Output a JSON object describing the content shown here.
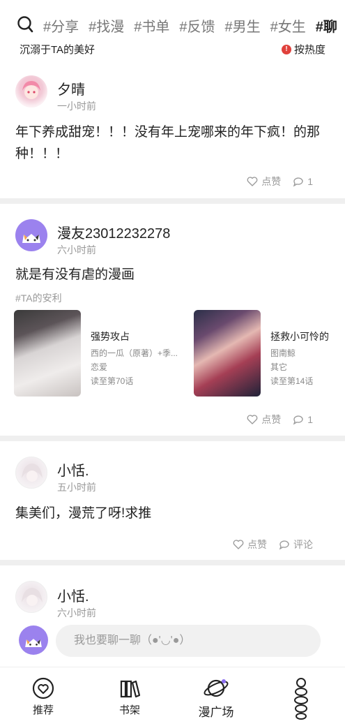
{
  "topbar": {
    "tags": [
      "#分享",
      "#找漫",
      "#书单",
      "#反馈",
      "#男生",
      "#女生",
      "#聊"
    ],
    "slogan": "沉溺于TA的美好",
    "sort_label": "按热度"
  },
  "posts": [
    {
      "user": "夕晴",
      "time": "一小时前",
      "content": "年下养成甜宠！！！没有年上宠哪来的年下疯！的那种！！！",
      "like_label": "点赞",
      "comment_label": "1"
    },
    {
      "user": "漫友23012232278",
      "time": "六小时前",
      "content": "就是有没有虐的漫画",
      "hashtag": "#TA的安利",
      "comics": [
        {
          "title": "强势攻占",
          "author": "西的一瓜（原著）+季...",
          "genre": "恋爱",
          "progress": "读至第70话"
        },
        {
          "title": "拯救小可怜的",
          "author": "图南鲸",
          "genre": "其它",
          "progress": "读至第14话"
        }
      ],
      "like_label": "点赞",
      "comment_label": "1"
    },
    {
      "user": "小恬.",
      "time": "五小时前",
      "content": "集美们，漫荒了呀!求推",
      "like_label": "点赞",
      "comment_label": "评论"
    },
    {
      "user": "小恬.",
      "time": "六小时前"
    }
  ],
  "comment_bar": {
    "placeholder": "我也要聊一聊（●'◡'●）"
  },
  "bottom_nav": {
    "items": [
      {
        "label": "推荐",
        "icon": "heart-circle-icon"
      },
      {
        "label": "书架",
        "icon": "bookshelf-icon"
      },
      {
        "label": "漫广场",
        "icon": "planet-icon"
      },
      {
        "label": "",
        "icon": "character-icon"
      }
    ]
  }
}
